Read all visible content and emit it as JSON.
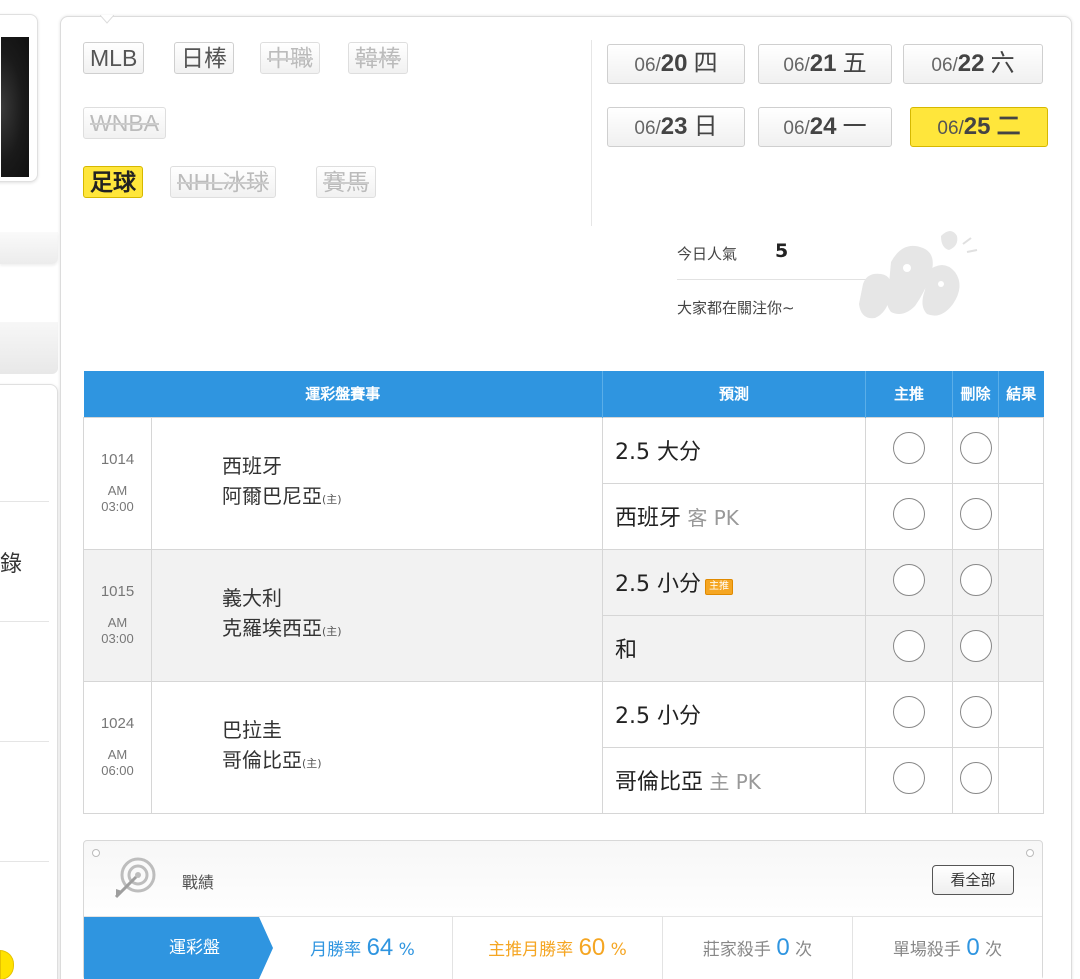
{
  "sidebar": {
    "partial_char": "錄"
  },
  "leagues": {
    "items": [
      {
        "label": "MLB",
        "state": "normal"
      },
      {
        "label": "日棒",
        "state": "normal"
      },
      {
        "label": "中職",
        "state": "disabled"
      },
      {
        "label": "韓棒",
        "state": "disabled"
      },
      {
        "label": "WNBA",
        "state": "disabled"
      },
      {
        "label": "足球",
        "state": "active"
      },
      {
        "label": "NHL冰球",
        "state": "disabled"
      },
      {
        "label": "賽馬",
        "state": "disabled"
      }
    ]
  },
  "dates": [
    {
      "prefix": "06/",
      "day": "20",
      "weekday": "四",
      "active": false
    },
    {
      "prefix": "06/",
      "day": "21",
      "weekday": "五",
      "active": false
    },
    {
      "prefix": "06/",
      "day": "22",
      "weekday": "六",
      "active": false
    },
    {
      "prefix": "06/",
      "day": "23",
      "weekday": "日",
      "active": false
    },
    {
      "prefix": "06/",
      "day": "24",
      "weekday": "一",
      "active": false
    },
    {
      "prefix": "06/",
      "day": "25",
      "weekday": "二",
      "active": true
    }
  ],
  "popularity": {
    "label": "今日人氣",
    "value": "5",
    "subtitle": "大家都在關注你∼"
  },
  "table": {
    "headers": {
      "match": "運彩盤賽事",
      "prediction": "預測",
      "main": "主推",
      "delete": "刪除",
      "result": "結果"
    },
    "matches": [
      {
        "number": "1014",
        "ampm": "AM",
        "time": "03:00",
        "away": "西班牙",
        "home": "阿爾巴尼亞",
        "home_mark": "(主)",
        "predictions": [
          {
            "main": "2.5 大分",
            "dim": "",
            "badge": ""
          },
          {
            "main": "西班牙",
            "dim": " 客 PK",
            "badge": ""
          }
        ]
      },
      {
        "number": "1015",
        "ampm": "AM",
        "time": "03:00",
        "away": "義大利",
        "home": "克羅埃西亞",
        "home_mark": "(主)",
        "predictions": [
          {
            "main": "2.5 小分",
            "dim": "",
            "badge": "主推"
          },
          {
            "main": "和",
            "dim": "",
            "badge": ""
          }
        ]
      },
      {
        "number": "1024",
        "ampm": "AM",
        "time": "06:00",
        "away": "巴拉圭",
        "home": "哥倫比亞",
        "home_mark": "(主)",
        "predictions": [
          {
            "main": "2.5 小分",
            "dim": "",
            "badge": ""
          },
          {
            "main": "哥倫比亞",
            "dim": " 主 PK",
            "badge": ""
          }
        ]
      }
    ]
  },
  "record": {
    "title": "戰績",
    "view_all": "看全部",
    "tab": "運彩盤",
    "monthly_label": "月勝率",
    "monthly_value": "64",
    "main_monthly_label": "主推月勝率",
    "main_monthly_value": "60",
    "percent": "%",
    "banker_label": "莊家殺手",
    "banker_value": "0",
    "single_label": "單場殺手",
    "single_value": "0",
    "times": "次"
  },
  "colors": {
    "accent_blue": "#2f95e0",
    "active_yellow": "#ffe63b",
    "orange": "#f5a623"
  }
}
